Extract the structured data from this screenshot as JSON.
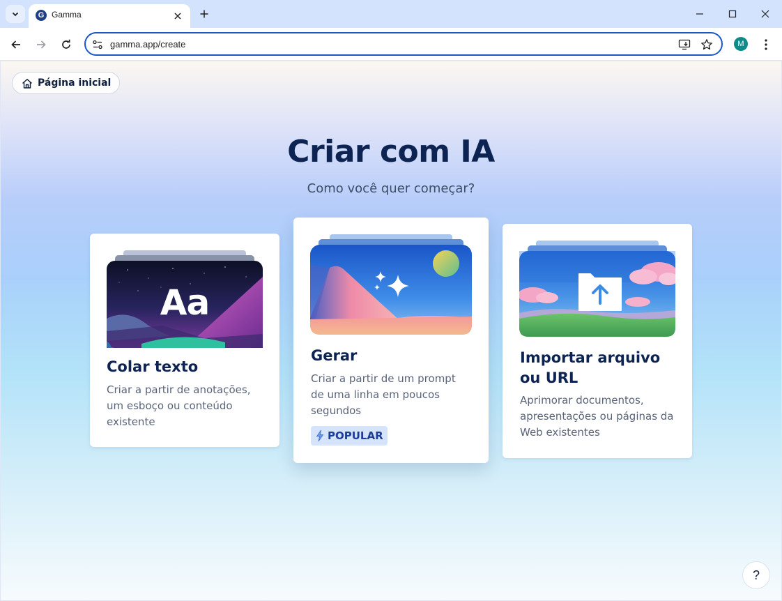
{
  "browser": {
    "tab_title": "Gamma",
    "tab_favicon_letter": "G",
    "url": "gamma.app/create",
    "profile_initial": "M"
  },
  "page": {
    "home_button_label": "Página inicial",
    "title": "Criar com IA",
    "subtitle": "Como você quer começar?",
    "cards": [
      {
        "title": "Colar texto",
        "description": "Criar a partir de anotações, um esboço ou conteúdo existente",
        "art_text": "Aa"
      },
      {
        "title": "Gerar",
        "description": "Criar a partir de um prompt de uma linha em poucos segundos",
        "badge": "POPULAR"
      },
      {
        "title": "Importar arquivo ou URL",
        "description": "Aprimorar documentos, apresentações ou páginas da Web existentes"
      }
    ],
    "help_label": "?"
  }
}
